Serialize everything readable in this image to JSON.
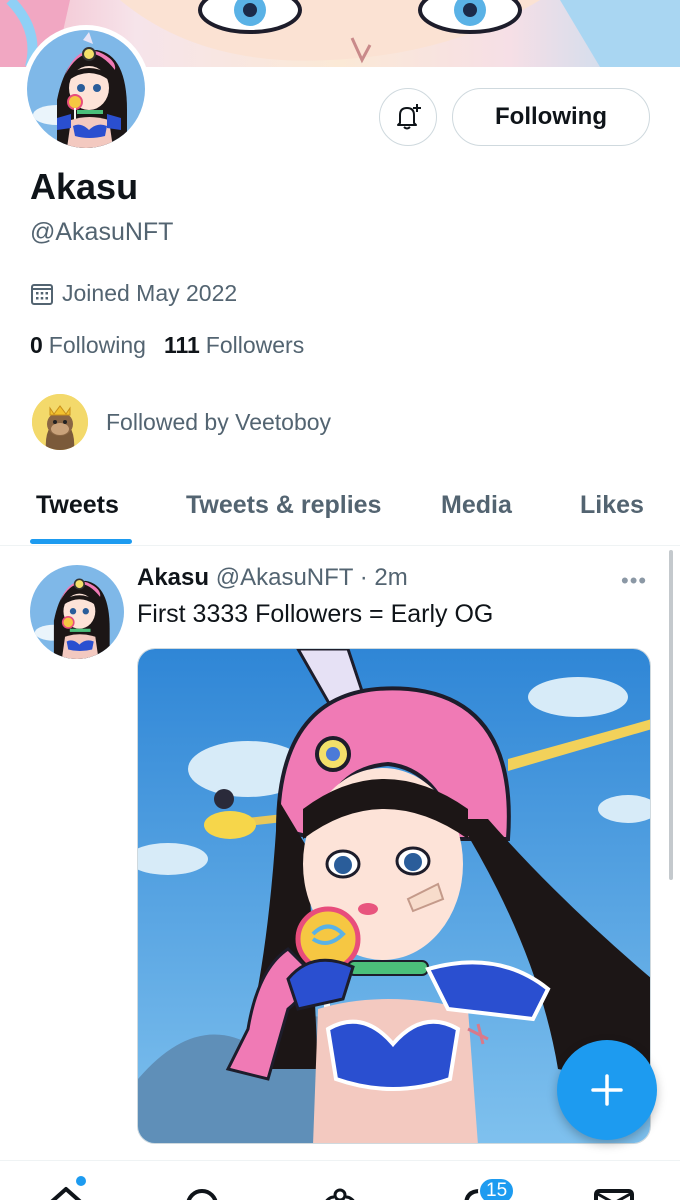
{
  "profile": {
    "name": "Akasu",
    "handle": "@AkasuNFT",
    "joined": "Joined May 2022",
    "following_count": "0",
    "following_label": "Following",
    "followers_count": "111",
    "followers_label": "Followers",
    "followed_by": "Followed by Veetoboy"
  },
  "actions": {
    "following_button": "Following",
    "notify_icon": "bell-plus-icon"
  },
  "tabs": [
    {
      "label": "Tweets",
      "active": true
    },
    {
      "label": "Tweets & replies",
      "active": false
    },
    {
      "label": "Media",
      "active": false
    },
    {
      "label": "Likes",
      "active": false
    }
  ],
  "tweet": {
    "name": "Akasu",
    "handle": "@AkasuNFT",
    "time": "· 2m",
    "text": "First 3333 Followers = Early OG",
    "more_icon": "more-horizontal-icon"
  },
  "bottom_nav": {
    "items": [
      "home-icon",
      "search-icon",
      "spaces-icon",
      "notifications-icon",
      "messages-icon"
    ],
    "notifications_badge": "15"
  },
  "colors": {
    "accent": "#1d9bf0",
    "text_primary": "#0f1419",
    "text_secondary": "#536471",
    "border": "#cfd9de"
  }
}
